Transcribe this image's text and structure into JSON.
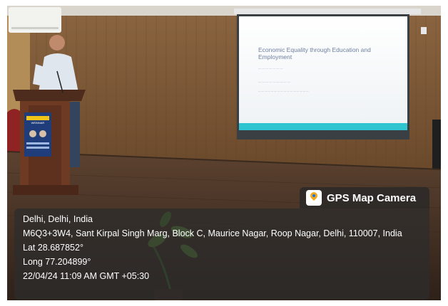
{
  "photo": {
    "slide": {
      "title": "Economic Equality through Education and Employment"
    },
    "banner": {
      "title": "WEBINAR"
    }
  },
  "overlay": {
    "app_name": "GPS Map Camera",
    "location": "Delhi, Delhi, India",
    "address": "M6Q3+3W4, Sant Kirpal Singh Marg, Block C, Maurice Nagar, Roop Nagar, Delhi, 110007, India",
    "latitude": "Lat 28.687852°",
    "longitude": "Long 77.204899°",
    "timestamp": "22/04/24 11:09 AM GMT +05:30"
  },
  "colors": {
    "wall_wood": "#7a5634",
    "floor_wood": "#4a3525",
    "projection_bar": "#2ec4d0",
    "overlay_bg": "#2d2d2d",
    "gps_pin": "#f2a81d"
  }
}
